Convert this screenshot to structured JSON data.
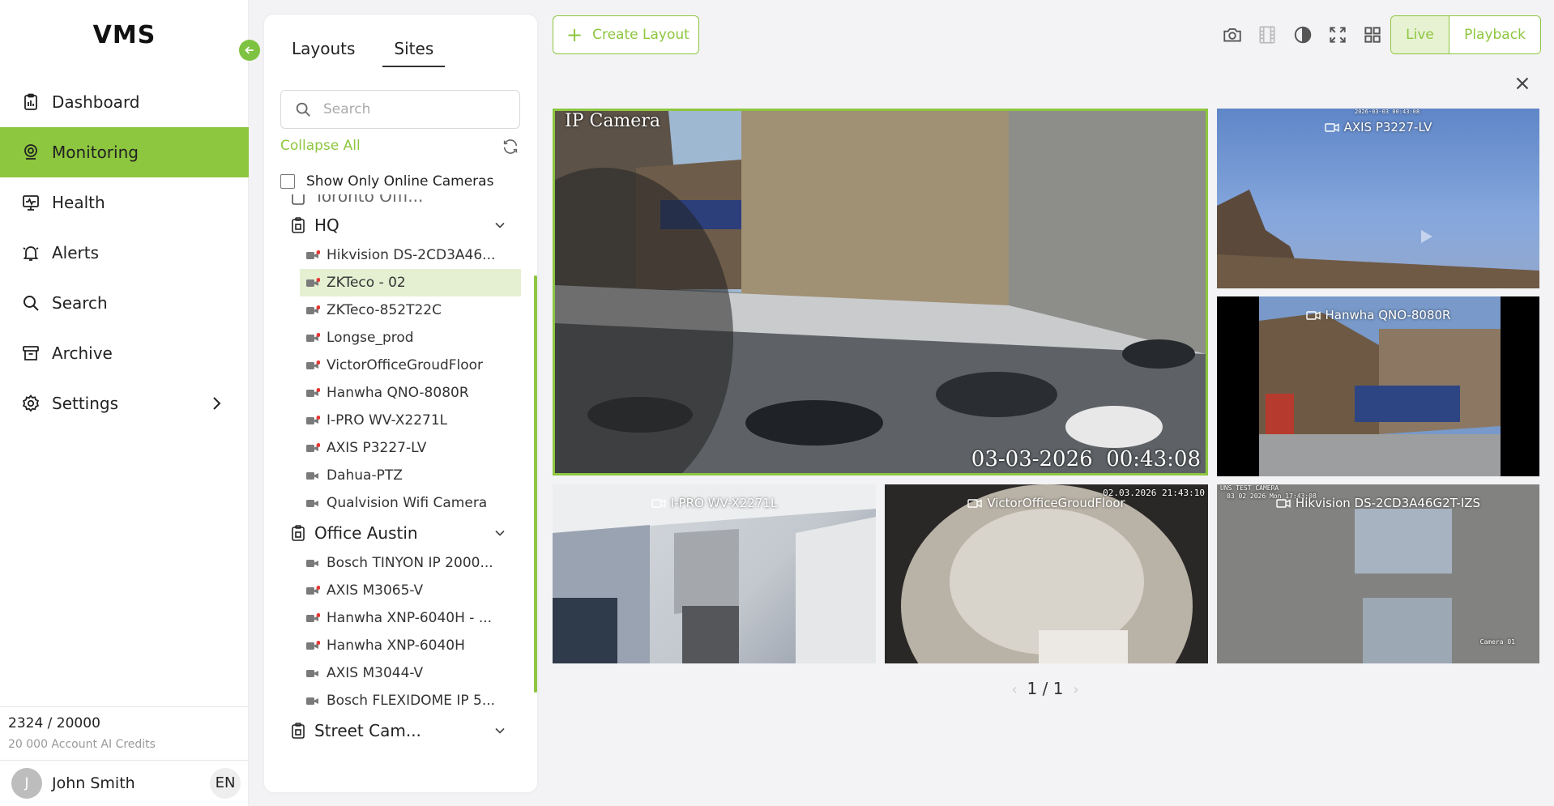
{
  "app": {
    "logo": "VMS"
  },
  "nav": {
    "items": [
      {
        "label": "Dashboard",
        "icon": "clipboard-icon"
      },
      {
        "label": "Monitoring",
        "icon": "eye-icon",
        "active": true
      },
      {
        "label": "Health",
        "icon": "monitor-heart-icon"
      },
      {
        "label": "Alerts",
        "icon": "bell-icon"
      },
      {
        "label": "Search",
        "icon": "search-icon"
      },
      {
        "label": "Archive",
        "icon": "archive-icon"
      },
      {
        "label": "Settings",
        "icon": "gear-icon"
      }
    ],
    "credits_value": "2324 / 20000",
    "credits_label": "20 000 Account AI Credits",
    "user_initial": "J",
    "user_name": "John Smith",
    "language": "EN"
  },
  "tree_panel": {
    "tabs": [
      "Layouts",
      "Sites"
    ],
    "active_tab": "Sites",
    "search_placeholder": "Search",
    "collapse_all": "Collapse All",
    "online_only_label": "Show Only Online Cameras",
    "partial_group": "Toronto Offi...",
    "groups": [
      {
        "name": "HQ",
        "cameras": [
          {
            "name": "Hikvision DS-2CD3A46...",
            "status": "online"
          },
          {
            "name": "ZKTeco - 02",
            "status": "online",
            "selected": true
          },
          {
            "name": "ZKTeco-852T22C",
            "status": "online"
          },
          {
            "name": "Longse_prod",
            "status": "online"
          },
          {
            "name": "VictorOfficeGroudFloor",
            "status": "online"
          },
          {
            "name": "Hanwha QNO-8080R",
            "status": "online"
          },
          {
            "name": "I-PRO WV-X2271L",
            "status": "online"
          },
          {
            "name": "AXIS P3227-LV",
            "status": "online"
          },
          {
            "name": "Dahua-PTZ",
            "status": "offline"
          },
          {
            "name": "Qualvision Wifi Camera",
            "status": "offline"
          }
        ]
      },
      {
        "name": "Office Austin",
        "cameras": [
          {
            "name": "Bosch TINYON IP 2000...",
            "status": "offline"
          },
          {
            "name": "AXIS M3065-V",
            "status": "online"
          },
          {
            "name": "Hanwha XNP-6040H - ...",
            "status": "online"
          },
          {
            "name": "Hanwha XNP-6040H",
            "status": "online"
          },
          {
            "name": "AXIS M3044-V",
            "status": "offline"
          },
          {
            "name": "Bosch FLEXIDOME IP 5...",
            "status": "offline"
          }
        ]
      },
      {
        "name": "Street Cam...",
        "cameras": []
      }
    ]
  },
  "toolbar": {
    "create_layout": "Create Layout",
    "icons": [
      "camera-snapshot-icon",
      "film-icon",
      "contrast-icon",
      "fullscreen-icon",
      "grid-layout-icon"
    ],
    "live": "Live",
    "playback": "Playback"
  },
  "grid": {
    "tiles": [
      {
        "label": "",
        "osd_top_left": "IP Camera",
        "osd_bottom_right": "03-03-2026  00:43:08"
      },
      {
        "label": "AXIS P3227-LV",
        "osd_top_center": "2026-03-03 00:43:08"
      },
      {
        "label": "Hanwha QNO-8080R"
      },
      {
        "label": "I-PRO WV-X2271L"
      },
      {
        "label": "VictorOfficeGroudFloor",
        "osd_top_right": "02.03.2026 21:43:10"
      },
      {
        "label": "Hikvision DS-2CD3A46G2T-IZS",
        "osd_top_left": "UNS TEST CAMERA",
        "osd_top_left_2": "03 02 2026 Mon 17:43:08",
        "osd_bottom_right": "Camera 01"
      }
    ],
    "page": "1 / 1"
  },
  "colors": {
    "accent": "#8dc63f",
    "online_dot": "#e53935",
    "camera_icon": "#7a7a7a"
  }
}
